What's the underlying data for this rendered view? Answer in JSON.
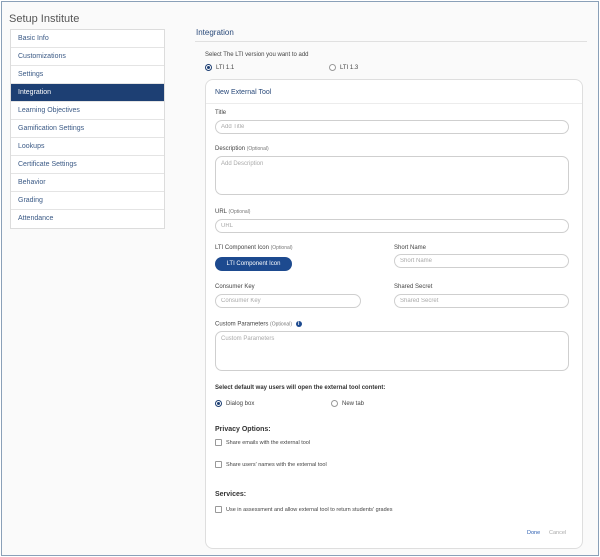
{
  "page": {
    "title": "Setup Institute"
  },
  "sidebar": {
    "items": [
      {
        "label": "Basic Info",
        "active": false
      },
      {
        "label": "Customizations",
        "active": false
      },
      {
        "label": "Settings",
        "active": false
      },
      {
        "label": "Integration",
        "active": true
      },
      {
        "label": "Learning Objectives",
        "active": false
      },
      {
        "label": "Gamification Settings",
        "active": false
      },
      {
        "label": "Lookups",
        "active": false
      },
      {
        "label": "Certificate Settings",
        "active": false
      },
      {
        "label": "Behavior",
        "active": false
      },
      {
        "label": "Grading",
        "active": false
      },
      {
        "label": "Attendance",
        "active": false
      }
    ]
  },
  "main": {
    "section_title": "Integration",
    "lti_prompt": "Select The LTI version you want to add",
    "lti_options": {
      "v11": "LTI 1.1",
      "v13": "LTI 1.3",
      "selected": "LTI 1.1"
    },
    "card": {
      "title": "New External Tool",
      "title_field": {
        "label": "Title",
        "placeholder": "Add Title",
        "value": ""
      },
      "description_field": {
        "label": "Description",
        "optional": "(Optional)",
        "placeholder": "Add Description",
        "value": ""
      },
      "url_field": {
        "label": "URL",
        "optional": "(Optional)",
        "placeholder": "URL",
        "value": ""
      },
      "icon_field": {
        "label": "LTI Component Icon",
        "optional": "(Optional)",
        "button": "LTI Component Icon"
      },
      "short_name_field": {
        "label": "Short Name",
        "placeholder": "Short Name",
        "value": ""
      },
      "consumer_key_field": {
        "label": "Consumer Key",
        "placeholder": "Consumer Key",
        "value": ""
      },
      "shared_secret_field": {
        "label": "Shared Secret",
        "placeholder": "Shared Secret",
        "value": ""
      },
      "custom_params_field": {
        "label": "Custom Parameters",
        "optional": "(Optional)",
        "placeholder": "Custom Parameters",
        "value": ""
      },
      "open_mode": {
        "label": "Select default way users will open the external tool content:",
        "dialog": "Dialog box",
        "newtab": "New tab",
        "selected": "Dialog box"
      },
      "privacy": {
        "heading": "Privacy Options:",
        "share_emails": "Share emails with the external tool",
        "share_names": "Share users' names with the external tool"
      },
      "services": {
        "heading": "Services:",
        "use_assessment": "Use in assessment and allow external tool to return students' grades"
      },
      "actions": {
        "done": "Done",
        "cancel": "Cancel"
      }
    }
  },
  "colors": {
    "accent": "#1d3f73",
    "button": "#1d4a8f",
    "link_done": "#2a5db0",
    "link_cancel": "#aaaaaa"
  }
}
